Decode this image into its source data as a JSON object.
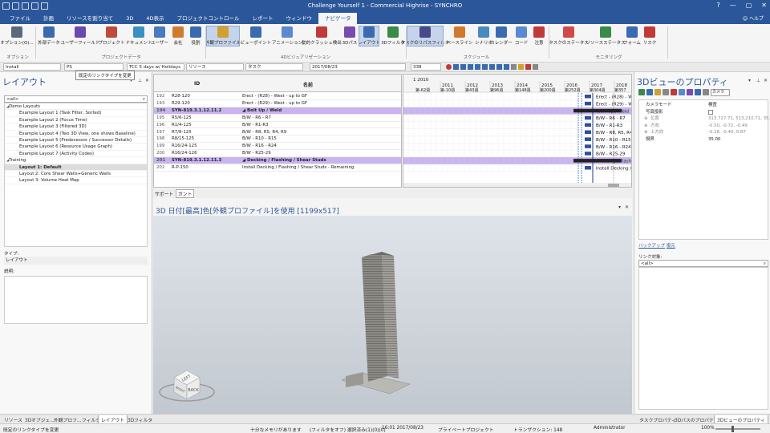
{
  "window": {
    "title": "Challenge Yourself 1 - Commercial Highrise - SYNCHRO",
    "controls": [
      "?",
      "—",
      "▢",
      "✕"
    ]
  },
  "ribbon_tabs": [
    "ファイル",
    "計画",
    "リソースを割り当て",
    "3D",
    "4D表示",
    "プロジェクトコントロール",
    "レポート",
    "ウィンドウ",
    "ナビゲータ"
  ],
  "active_tab_index": 8,
  "help_label": "ヘルプ",
  "ribbon": {
    "buttons": [
      {
        "label": "オプション(O)...",
        "color": "#5a6a7a"
      },
      {
        "label": "外部データ",
        "color": "#3a6ab0"
      },
      {
        "label": "ユーザーフィールド",
        "color": "#6a4ab0"
      },
      {
        "label": "プロジェクト",
        "color": "#c04a3a"
      },
      {
        "label": "ドキュメント",
        "color": "#3a90c0"
      },
      {
        "label": "ユーザー",
        "color": "#4a7ac0"
      },
      {
        "label": "会社",
        "color": "#d07a30"
      },
      {
        "label": "役割",
        "color": "#3a6ab0"
      },
      {
        "label": "外観プロファイル",
        "color": "#d0a030"
      },
      {
        "label": "ビューポイント",
        "color": "#3a6ab0"
      },
      {
        "label": "アニメーション",
        "color": "#5a8ad0"
      },
      {
        "label": "動的クラッシュ検出",
        "color": "#c03a3a"
      },
      {
        "label": "3Dパス",
        "color": "#7a4ab0"
      },
      {
        "label": "レイアウト",
        "color": "#3a6ab0"
      },
      {
        "label": "3Dフィルタ",
        "color": "#3a8a4a"
      },
      {
        "label": "タスクのリパスフィルタ",
        "color": "#4a4a8a"
      },
      {
        "label": "ベースライン",
        "color": "#d07a30"
      },
      {
        "label": "シナリオ",
        "color": "#4a8ac0"
      },
      {
        "label": "カレンダー",
        "color": "#3a6ab0"
      },
      {
        "label": "コード",
        "color": "#5a8ad0"
      },
      {
        "label": "注意",
        "color": "#c03a3a"
      },
      {
        "label": "タスクのステータス",
        "color": "#d04a4a"
      },
      {
        "label": "リソースステータス",
        "color": "#3a8a4a"
      },
      {
        "label": "フォーム",
        "color": "#3a6ab0"
      },
      {
        "label": "リスク",
        "color": "#c03a3a"
      }
    ],
    "groups": [
      "オプション",
      "プロジェクトデータ",
      "4Dビジュアリゼーション",
      "スケジュール",
      "モニタリング"
    ]
  },
  "toolbar": {
    "combo_install": "Install",
    "combo_ps": "PS",
    "combo_calendar": "TCC 5 days w/ Holidays",
    "combo_resource": "リソース",
    "combo_task": "タスク",
    "combo_date": "2017/08/23",
    "combo_zoom": "338"
  },
  "tooltip": "既定のリンクタイプを変更",
  "left_panel": {
    "title": "レイアウト",
    "search_placeholder": "<all>",
    "tree": [
      {
        "label": "Demo Layouts",
        "type": "group"
      },
      {
        "label": "Example Layout 1 (Task Filter, Sorted)",
        "type": "child"
      },
      {
        "label": "Example Layout 2 (Focus Time)",
        "type": "child"
      },
      {
        "label": "Example Layout 3 (Filtered 3D)",
        "type": "child"
      },
      {
        "label": "Example Layout 4 (Two 3D View, one shows Baseline)",
        "type": "child"
      },
      {
        "label": "Example Layout 5 (Predecessor / Successor Details)",
        "type": "child"
      },
      {
        "label": "Example Layout 6 (Resource Usage Graph)",
        "type": "child"
      },
      {
        "label": "Example Layout 7 (Activity Codes)",
        "type": "child"
      },
      {
        "label": "Training",
        "type": "group"
      },
      {
        "label": "Layout 1: Default",
        "type": "child",
        "selected": true
      },
      {
        "label": "Layout 2: Core Shear Walls+Generic Walls",
        "type": "child"
      },
      {
        "label": "Layout 3: Volume Heat Map",
        "type": "child"
      }
    ],
    "type_label": "タイプ:",
    "type_value": "レイアウト",
    "desc_label": "説明:"
  },
  "grid": {
    "col_id": "ID",
    "col_name": "名前",
    "rows": [
      {
        "n": "192",
        "id": "R28-120",
        "name": "Erect - (R28) - West - up to GF",
        "summary": false
      },
      {
        "n": "193",
        "id": "R29-120",
        "name": "Erect - (R29) - West - up to GF",
        "summary": false
      },
      {
        "n": "194",
        "id": "SYN-819.3.1.12.11.2",
        "name": "◢ Bolt Up / Weld",
        "summary": true
      },
      {
        "n": "195",
        "id": "R5/6-125",
        "name": "B/W - R6 - R7",
        "summary": false
      },
      {
        "n": "196",
        "id": "R1/4-125",
        "name": "B/W - R1-R3",
        "summary": false
      },
      {
        "n": "197",
        "id": "R7/8-125",
        "name": "B/W - R8, R5, R4, R9",
        "summary": false
      },
      {
        "n": "198",
        "id": "R8/15-125",
        "name": "B/W - R10 - R15",
        "summary": false
      },
      {
        "n": "199",
        "id": "R16/24-125",
        "name": "B/W - R16 - R24",
        "summary": false
      },
      {
        "n": "200",
        "id": "R16/24-126",
        "name": "B/W - R25-29",
        "summary": false
      },
      {
        "n": "201",
        "id": "SYN-819.3.1.12.11.3",
        "name": "◢ Decking / Flashing / Shear Studs",
        "summary": true
      },
      {
        "n": "202",
        "id": "R-P-150",
        "name": "Install Decking / Flashing / Shear Studs - Remaining",
        "summary": false
      }
    ]
  },
  "gantt": {
    "top_label": "1 2010",
    "years": [
      "2011",
      "2012",
      "2013",
      "2014",
      "2015",
      "2016",
      "2017",
      "2018"
    ],
    "weeks": [
      "第-62週",
      "第-10週",
      "第43週",
      "第96週",
      "第148週",
      "第200週",
      "第252週",
      "第304週",
      "第357"
    ],
    "bar_labels": [
      "Erect - (R28) - W",
      "Erect - (R29) - W",
      "Bolt Up / Weld",
      "B/W - R6 - R7",
      "B/W - R1-R3",
      "B/W - R8, R5, R4, R9",
      "B/W - R10 - R15",
      "B/W - R16 - R24",
      "B/W - R25-29",
      "Decking / Flash",
      "Install Decking /"
    ]
  },
  "split_tabs": [
    "サポート",
    "ガント"
  ],
  "view3d": {
    "title": "3D 日付[最高]色[外観プロファイル]を使用  [1199x517]",
    "cube_top": "LEFT",
    "cube_right": "BACK",
    "cube_left": "RIGHT"
  },
  "right_panel": {
    "title": "3Dビューのプロパティ",
    "camera_tab": "カメラ",
    "props": [
      {
        "k": "カメラモード",
        "v": "検査",
        "sub": false
      },
      {
        "k": "写真投影",
        "v": "",
        "sub": false,
        "checkbox": true
      },
      {
        "k": "位置",
        "v": "313.727.71, 513,210.71, 35...",
        "sub": true
      },
      {
        "k": "方向",
        "v": "-0.50, -0.72, -0.49",
        "sub": true
      },
      {
        "k": "上方向",
        "v": "-0.28, -0.40, 0.87",
        "sub": true
      },
      {
        "k": "視界",
        "v": "35.00",
        "sub": false
      }
    ],
    "link_backup": "バックアップ",
    "link_restore": "復元",
    "link_obj_label": "リンク対象:",
    "link_search": "<all>"
  },
  "bottom_tabs_left": [
    "リソース",
    "3Dオブジェ...",
    "外観プロフ...",
    "フィルタ",
    "レイアウト",
    "3Dフィルタ"
  ],
  "bottom_tabs_left_active": 4,
  "bottom_tabs_right": [
    "タスクプロパティ",
    "3Dパスのプロパティ",
    "3Dビューのプロパティ"
  ],
  "bottom_tabs_right_active": 2,
  "status": {
    "left": "既定のリンクタイプを変更",
    "memory": "十分なメモリがあります",
    "filter": "(フィルタをオフ) 選択済み(1)(0)(0)",
    "datetime": "16:01 2017/08/23",
    "private": "プライベートプロジェクト",
    "transaction": "トランザクション: 148",
    "user": "Administrator",
    "zoom": "100%"
  }
}
